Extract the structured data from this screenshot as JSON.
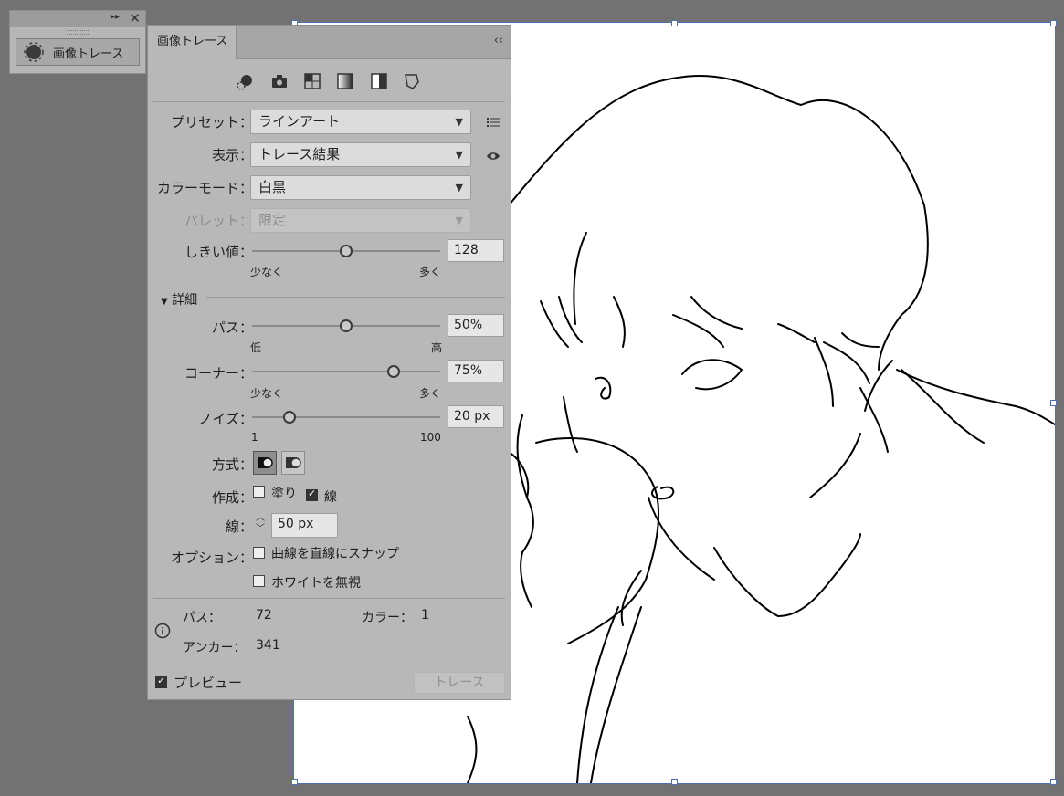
{
  "dock": {
    "button_label": "画像トレース",
    "collapse_glyph": "▸▸",
    "close_glyph": "✕"
  },
  "panel": {
    "tab_title": "画像トレース",
    "collapse_glyph": "‹‹",
    "preset_icons": [
      "auto-color-icon",
      "high-color-icon",
      "low-color-icon",
      "grayscale-icon",
      "black-white-icon",
      "outline-icon"
    ],
    "preset": {
      "label": "プリセット",
      "value": "ラインアート"
    },
    "view": {
      "label": "表示",
      "value": "トレース結果"
    },
    "mode": {
      "label": "カラーモード",
      "value": "白黒"
    },
    "palette": {
      "label": "パレット",
      "value": "限定"
    },
    "threshold": {
      "label": "しきい値",
      "value": "128",
      "min_label": "少なく",
      "max_label": "多く",
      "level": 0.5
    },
    "advanced": {
      "label": "詳細"
    },
    "paths": {
      "label": "パス",
      "value": "50%",
      "min_label": "低",
      "max_label": "高",
      "level": 0.5
    },
    "corners": {
      "label": "コーナー",
      "value": "75%",
      "min_label": "少なく",
      "max_label": "多く",
      "level": 0.75
    },
    "noise": {
      "label": "ノイズ",
      "value": "20 px",
      "min_label": "1",
      "max_label": "100",
      "level": 0.2
    },
    "method": {
      "label": "方式"
    },
    "create": {
      "label": "作成",
      "fill_label": "塗り",
      "fill_checked": false,
      "stroke_label": "線",
      "stroke_checked": true
    },
    "stroke": {
      "label": "線",
      "value": "50 px"
    },
    "options": {
      "label": "オプション",
      "snap_label": "曲線を直線にスナップ",
      "snap_checked": false,
      "ignore_white_label": "ホワイトを無視",
      "ignore_white_checked": false
    },
    "info": {
      "paths_label": "パス：",
      "paths_value": "72",
      "colors_label": "カラー：",
      "colors_value": "1",
      "anchors_label": "アンカー：",
      "anchors_value": "341"
    },
    "preview": {
      "label": "プレビュー",
      "checked": true
    },
    "trace_button": "トレース"
  },
  "colors": {
    "panel": "#b8b8b8",
    "canvas": "#727272",
    "selection": "#4d6fb3"
  }
}
